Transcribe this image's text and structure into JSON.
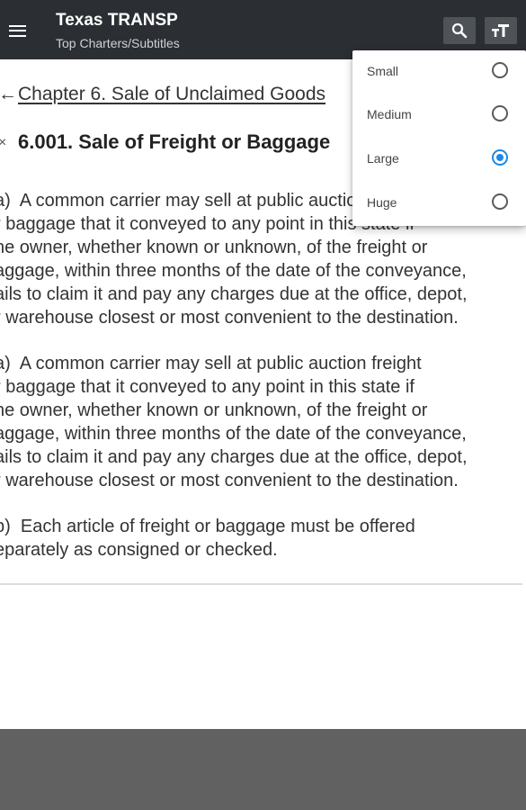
{
  "header": {
    "title": "Texas TRANSP",
    "subtitle": "Top Charters/Subtitles",
    "menu_icon": "hamburger-menu-icon",
    "search_icon": "search-icon",
    "text_size_icon": "text-size-icon"
  },
  "breadcrumb": {
    "arrow": "←",
    "label": "Chapter 6. Sale of Unclaimed Goods"
  },
  "section": {
    "symbol": "×",
    "title": "6.001. Sale of Freight or Baggage"
  },
  "paragraphs": [
    "a)  A common carrier may sell at public auction freight\nr baggage that it conveyed to any point in this state if\nhe owner, whether known or unknown, of the freight or\naggage, within three months of the date of the conveyance,\nails to claim it and pay any charges due at the office, depot,\nr warehouse closest or most convenient to the destination.",
    "a)  A common carrier may sell at public auction freight\nr baggage that it conveyed to any point in this state if\nhe owner, whether known or unknown, of the freight or\naggage, within three months of the date of the conveyance,\nails to claim it and pay any charges due at the office, depot,\nr warehouse closest or most convenient to the destination.",
    "b)  Each article of freight or baggage must be offered\neparately as consigned or checked."
  ],
  "text_size_menu": {
    "options": [
      {
        "label": "Small",
        "checked": false
      },
      {
        "label": "Medium",
        "checked": false
      },
      {
        "label": "Large",
        "checked": true
      },
      {
        "label": "Huge",
        "checked": false
      }
    ]
  },
  "colors": {
    "app_bar": "#2b2f33",
    "radio_selected": "#1e88e5",
    "footer": "#616161"
  }
}
